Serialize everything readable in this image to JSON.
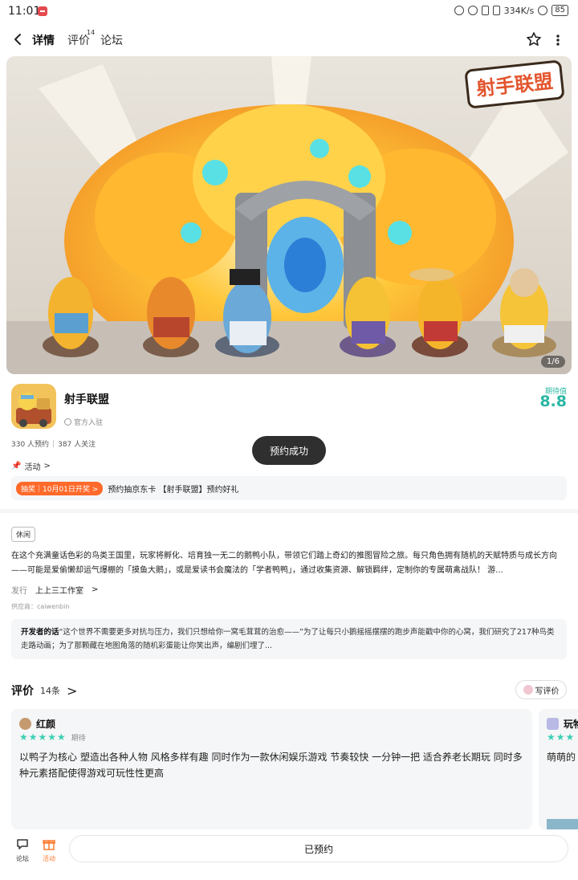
{
  "status_bar": {
    "time": "11:01",
    "speed": "334K/s",
    "battery": "85"
  },
  "nav": {
    "tab_detail": "详情",
    "tab_review": "评价",
    "tab_review_count": "14",
    "tab_forum": "论坛"
  },
  "banner": {
    "counter": "1/6",
    "logo_text": "射手联盟"
  },
  "app": {
    "title": "射手联盟",
    "official": "官方入驻",
    "expect_label": "期待值",
    "expect_score": "8.8",
    "reservations": "330 人预约",
    "followers": "387 人关注"
  },
  "toast": "预约成功",
  "activity_link": "活动",
  "promo": {
    "badge": "抽奖｜10月01日开奖 >",
    "text": "预约抽京东卡 【射手联盟】预约好礼"
  },
  "tag": "休闲",
  "description": "在这个充满童话色彩的鸟类王国里，玩家将孵化、培育独一无二的鹅鸭小队，带领它们踏上奇幻的推图冒险之旅。每只角色拥有随机的天赋特质与成长方向——可能是爱偷懒却运气爆棚的「摸鱼大鹅」，或是爱读书会魔法的「学者鸭鸭」，通过收集资源、解锁羁绊，定制你的专属萌禽战队！ 游...",
  "publisher": {
    "label": "发行",
    "name": "上上三工作室"
  },
  "supplier": "供应商：caiwenbin",
  "developer_note": {
    "label": "开发者的话",
    "text": "“这个世界不需要更多对抗与压力，我们只想给你一窝毛茸茸的治愈——”为了让每只小鹅摇摇摆摆的跑步声能戳中你的心窝，我们研究了217种鸟类走路动画；为了那颗藏在地图角落的随机彩蛋能让你笑出声，编剧们埋了..."
  },
  "reviews": {
    "title": "评价",
    "count": "14条",
    "write_label": "写评价",
    "items": [
      {
        "name": "红颜",
        "stars": "★★★★★",
        "note": "期待",
        "text": "以鸭子为核心 塑造出各种人物 风格多样有趣 同时作为一款休闲娱乐游戏 节奏较快 一分钟一把 适合养老长期玩 同时多种元素搭配使得游戏可玩性性更高"
      },
      {
        "name": "玩物",
        "stars": "★★★",
        "note": "",
        "text": "萌萌的 无厘头"
      }
    ]
  },
  "bottom_bar": {
    "forum_label": "论坛",
    "activity_label": "活动",
    "reserved_label": "已预约"
  },
  "colors": {
    "accent": "#2bb7a3",
    "promo": "#ff6a2b",
    "star": "#3ccfb5"
  }
}
